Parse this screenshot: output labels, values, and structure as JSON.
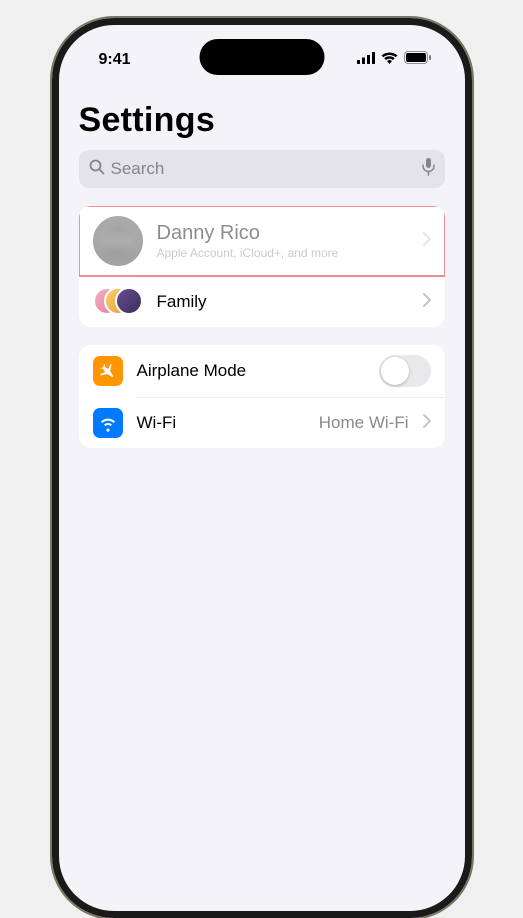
{
  "status": {
    "time": "9:41"
  },
  "page": {
    "title": "Settings"
  },
  "search": {
    "placeholder": "Search"
  },
  "account": {
    "name": "Danny Rico",
    "subtitle": "Apple Account, iCloud+, and more"
  },
  "family": {
    "label": "Family"
  },
  "network": {
    "airplane": {
      "label": "Airplane Mode",
      "on": false
    },
    "wifi": {
      "label": "Wi-Fi",
      "value": "Home Wi-Fi"
    }
  }
}
